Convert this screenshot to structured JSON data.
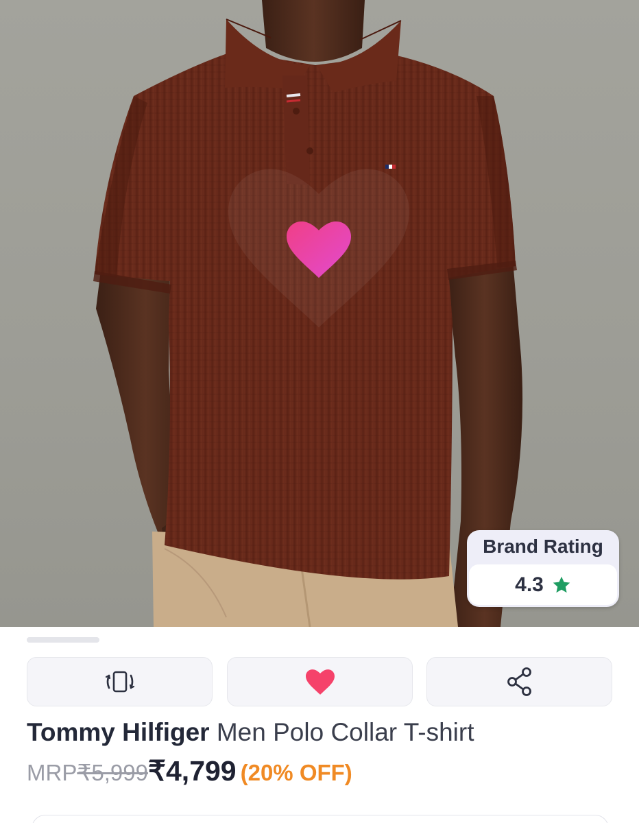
{
  "product_image": {
    "alt": "Model wearing a rust brown waffle-knit polo collar t-shirt with beige trousers"
  },
  "overlay": {
    "icon": "heart-icon",
    "color_from": "#f03f86",
    "color_to": "#e24bd0"
  },
  "brand_rating": {
    "title": "Brand Rating",
    "value": "4.3",
    "icon": "star-icon",
    "star_color": "#1f9d62"
  },
  "image_carousel": {
    "progress": 0.2
  },
  "actions": [
    {
      "icon": "phone-rotate-icon"
    },
    {
      "icon": "heart-icon",
      "color": "#f5426a"
    },
    {
      "icon": "share-icon"
    }
  ],
  "product": {
    "brand": "Tommy Hilfiger",
    "name": "Men Polo Collar T-shirt"
  },
  "pricing": {
    "mrp_label": "MRP",
    "mrp": "₹5,999",
    "price": "₹4,799",
    "discount": "(20% OFF)",
    "discount_color": "#f08a24"
  }
}
